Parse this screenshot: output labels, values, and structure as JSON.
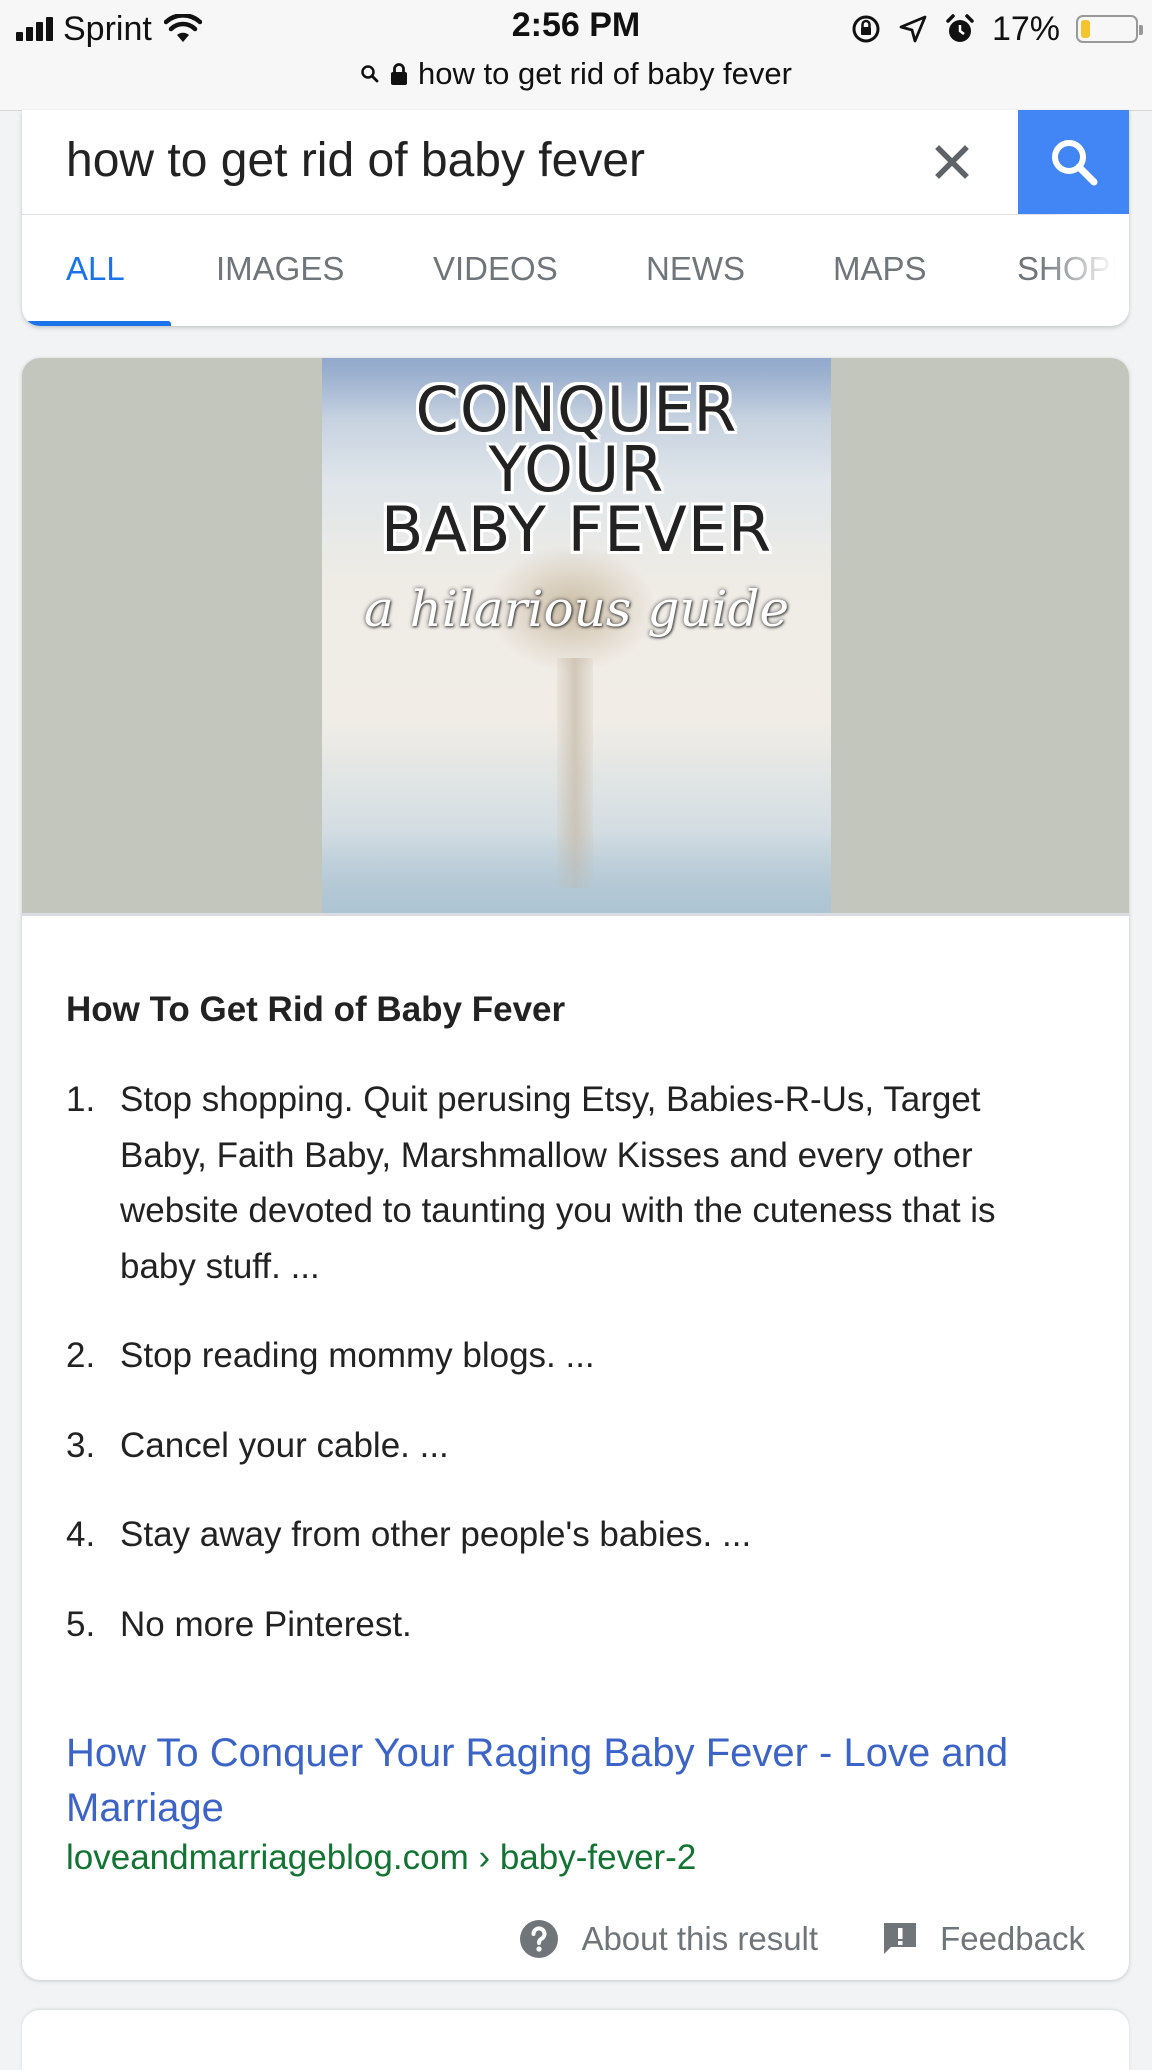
{
  "status_bar": {
    "carrier": "Sprint",
    "time": "2:56 PM",
    "battery_percent": "17%",
    "battery_level": 0.17,
    "icons": [
      "signal-bars-icon",
      "wifi-icon",
      "rotation-lock-icon",
      "location-arrow-icon",
      "alarm-icon",
      "battery-icon"
    ]
  },
  "url_bar": {
    "text": "how to get rid of baby fever",
    "icons": [
      "search-icon",
      "lock-icon"
    ]
  },
  "search": {
    "query": "how to get rid of baby fever",
    "clear_icon": "close-icon",
    "submit_icon": "search-icon",
    "accent_color": "#4285f4"
  },
  "tabs": [
    {
      "label": "ALL",
      "active": true
    },
    {
      "label": "IMAGES",
      "active": false
    },
    {
      "label": "VIDEOS",
      "active": false
    },
    {
      "label": "NEWS",
      "active": false
    },
    {
      "label": "MAPS",
      "active": false
    },
    {
      "label": "SHOPP",
      "active": false
    }
  ],
  "featured_snippet": {
    "image": {
      "line1": "CONQUER",
      "line2": "YOUR",
      "line3": "BABY FEVER",
      "subtitle": "a hilarious guide"
    },
    "title": "How To Get Rid of Baby Fever",
    "steps": [
      {
        "num": "1.",
        "text": "Stop shopping. Quit perusing Etsy, Babies-R-Us, Target Baby, Faith Baby, Marshmallow Kisses and every other website devoted to taunting you with the cuteness that is baby stuff. ..."
      },
      {
        "num": "2.",
        "text": "Stop reading mommy blogs. ..."
      },
      {
        "num": "3.",
        "text": "Cancel your cable. ..."
      },
      {
        "num": "4.",
        "text": "Stay away from other people's babies. ..."
      },
      {
        "num": "5.",
        "text": "No more Pinterest."
      }
    ],
    "link_text": "How To Conquer Your Raging Baby Fever - Love and Marriage",
    "cite": "loveandmarriageblog.com › baby-fever-2",
    "footer": {
      "about_label": "About this result",
      "about_icon": "help-circle-icon",
      "feedback_label": "Feedback",
      "feedback_icon": "feedback-flag-icon"
    },
    "link_color": "#3c63c6",
    "cite_color": "#137333"
  }
}
